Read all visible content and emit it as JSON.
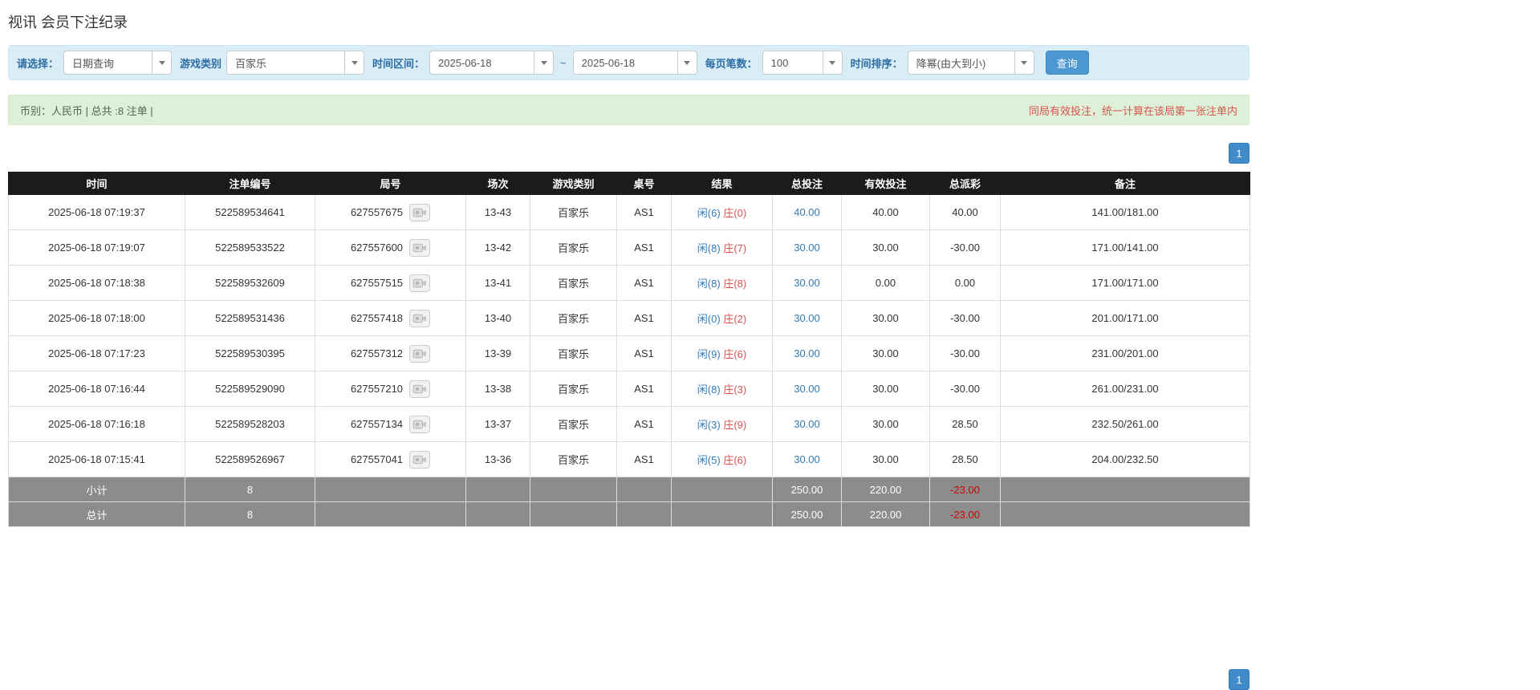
{
  "page": {
    "title": "视讯 会员下注纪录"
  },
  "filters": {
    "select_label": "请选择：",
    "select_value": "日期查询",
    "game_type_label": "游戏类别",
    "game_type_value": "百家乐",
    "date_range_label": "时间区间：",
    "date_from": "2025-06-18",
    "tilde": "~",
    "date_to": "2025-06-18",
    "page_size_label": "每页笔数：",
    "page_size_value": "100",
    "sort_label": "时间排序：",
    "sort_value": "降幂(由大到小)",
    "search_button": "查询"
  },
  "summary": {
    "left": "币别：人民币 | 总共 :8 注单 |",
    "right": "同局有效投注，统一计算在该局第一张注单内"
  },
  "pagination": {
    "page": "1"
  },
  "table": {
    "headers": [
      "时间",
      "注单编号",
      "局号",
      "场次",
      "游戏类别",
      "桌号",
      "结果",
      "总投注",
      "有效投注",
      "总派彩",
      "备注"
    ],
    "rows": [
      {
        "time": "2025-06-18 07:19:37",
        "bet_id": "522589534641",
        "round_id": "627557675",
        "session": "13-43",
        "game": "百家乐",
        "table_no": "AS1",
        "result_player": "闲(6)",
        "result_banker": "庄(0)",
        "total_bet": "40.00",
        "valid_bet": "40.00",
        "payout": "40.00",
        "note": "141.00/181.00"
      },
      {
        "time": "2025-06-18 07:19:07",
        "bet_id": "522589533522",
        "round_id": "627557600",
        "session": "13-42",
        "game": "百家乐",
        "table_no": "AS1",
        "result_player": "闲(8)",
        "result_banker": "庄(7)",
        "total_bet": "30.00",
        "valid_bet": "30.00",
        "payout": "-30.00",
        "note": "171.00/141.00"
      },
      {
        "time": "2025-06-18 07:18:38",
        "bet_id": "522589532609",
        "round_id": "627557515",
        "session": "13-41",
        "game": "百家乐",
        "table_no": "AS1",
        "result_player": "闲(8)",
        "result_banker": "庄(8)",
        "total_bet": "30.00",
        "valid_bet": "0.00",
        "payout": "0.00",
        "note": "171.00/171.00"
      },
      {
        "time": "2025-06-18 07:18:00",
        "bet_id": "522589531436",
        "round_id": "627557418",
        "session": "13-40",
        "game": "百家乐",
        "table_no": "AS1",
        "result_player": "闲(0)",
        "result_banker": "庄(2)",
        "total_bet": "30.00",
        "valid_bet": "30.00",
        "payout": "-30.00",
        "note": "201.00/171.00"
      },
      {
        "time": "2025-06-18 07:17:23",
        "bet_id": "522589530395",
        "round_id": "627557312",
        "session": "13-39",
        "game": "百家乐",
        "table_no": "AS1",
        "result_player": "闲(9)",
        "result_banker": "庄(6)",
        "total_bet": "30.00",
        "valid_bet": "30.00",
        "payout": "-30.00",
        "note": "231.00/201.00"
      },
      {
        "time": "2025-06-18 07:16:44",
        "bet_id": "522589529090",
        "round_id": "627557210",
        "session": "13-38",
        "game": "百家乐",
        "table_no": "AS1",
        "result_player": "闲(8)",
        "result_banker": "庄(3)",
        "total_bet": "30.00",
        "valid_bet": "30.00",
        "payout": "-30.00",
        "note": "261.00/231.00"
      },
      {
        "time": "2025-06-18 07:16:18",
        "bet_id": "522589528203",
        "round_id": "627557134",
        "session": "13-37",
        "game": "百家乐",
        "table_no": "AS1",
        "result_player": "闲(3)",
        "result_banker": "庄(9)",
        "total_bet": "30.00",
        "valid_bet": "30.00",
        "payout": "28.50",
        "note": "232.50/261.00"
      },
      {
        "time": "2025-06-18 07:15:41",
        "bet_id": "522589526967",
        "round_id": "627557041",
        "session": "13-36",
        "game": "百家乐",
        "table_no": "AS1",
        "result_player": "闲(5)",
        "result_banker": "庄(6)",
        "total_bet": "30.00",
        "valid_bet": "30.00",
        "payout": "28.50",
        "note": "204.00/232.50"
      }
    ],
    "subtotal": {
      "label": "小计",
      "count": "8",
      "total_bet": "250.00",
      "valid_bet": "220.00",
      "payout": "-23.00"
    },
    "total": {
      "label": "总计",
      "count": "8",
      "total_bet": "250.00",
      "valid_bet": "220.00",
      "payout": "-23.00"
    }
  }
}
